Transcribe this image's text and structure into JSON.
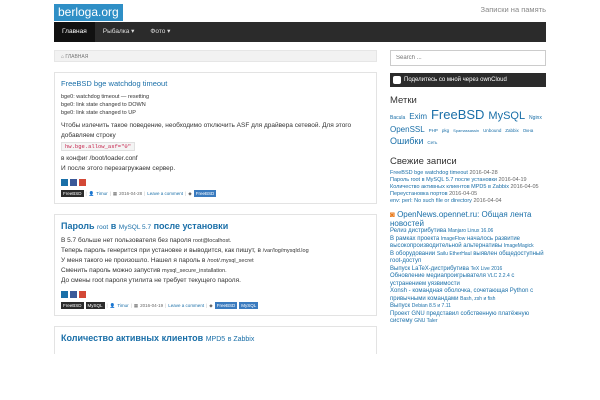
{
  "site": {
    "logo": "berloga.org",
    "tagline": "Записки на память"
  },
  "nav": {
    "items": [
      {
        "label": "Главная"
      },
      {
        "label": "Рыбалка ▾"
      },
      {
        "label": "Фото ▾"
      }
    ]
  },
  "breadcrumb": "ГЛАВНАЯ",
  "posts": [
    {
      "title": "FreeBSD bge watchdog timeout",
      "log": [
        "bge0: watchdog timeout — resetting",
        "bge0: link state changed to DOWN",
        "bge0: link state changed to UP"
      ],
      "p1": "Чтобы излечить такое поведение, необходимо отключить ASF для драйвера сетевой. Для этого добавляем строку",
      "code": "hw.bge.allow_asf=\"0\"",
      "p2": "в конфиг /boot/loader.conf",
      "p3": "И после этого перезагружаем сервер.",
      "meta": {
        "cat": "FreeBSD",
        "author": "Timur",
        "date": "2016-04-28",
        "comment": "Leave a comment",
        "tag": "FreeBSD"
      }
    },
    {
      "title_a": "Пароль",
      "title_b": "root",
      "title_c": "в",
      "title_d": "MySQL 5.7",
      "title_e": "после установки",
      "l1a": "В 5.7 больше нет пользователя без пароля",
      "l1b": "root@localhost.",
      "l2a": "Теперь пароль генерится при установке и выводится, как пишут, в",
      "l2b": "/var/log/mysqld.log",
      "l3a": "У меня такого не произошло. Нашел я пароль в",
      "l3b": "/root/.mysql_secret",
      "l4a": "Сменить пароль можно запустив",
      "l4b": "mysql_secure_installation.",
      "l5": "До смены root пароля утилита не требует текущего пароля.",
      "meta": {
        "cat1": "FreeBSD",
        "cat2": "MySQL",
        "author": "Timur",
        "date": "2016-04-19",
        "comment": "Leave a comment",
        "tag1": "FreeBSD",
        "tag2": "MySQL"
      }
    },
    {
      "title_a": "Количество активных клиентов",
      "title_b": "MPD5",
      "title_c": "в Zabbix"
    }
  ],
  "sidebar": {
    "search_placeholder": "Search ...",
    "owncloud_label": "Поделитесь со мной через ownCloud",
    "tags_title": "Метки",
    "tags": [
      {
        "t": "Bacula",
        "s": 5
      },
      {
        "t": "Exim",
        "s": 8
      },
      {
        "t": "FreeBSD",
        "s": 13
      },
      {
        "t": "MySQL",
        "s": 11
      },
      {
        "t": "Nginx",
        "s": 5
      },
      {
        "t": "OpenSSL",
        "s": 8
      },
      {
        "t": "PHP",
        "s": 4.5
      },
      {
        "t": "pkg",
        "s": 4.5
      },
      {
        "t": "Spamassassin",
        "s": 4
      },
      {
        "t": "Unbound",
        "s": 4.5
      },
      {
        "t": "Zabbix",
        "s": 4.5
      },
      {
        "t": "Окна",
        "s": 4.5
      },
      {
        "t": "Ошибки",
        "s": 9
      },
      {
        "t": "Сеть",
        "s": 4.5
      }
    ],
    "recent_title": "Свежие записи",
    "recent": [
      {
        "t": "FreeBSD bge watchdog timeout",
        "d": "2016-04-28"
      },
      {
        "t": "Пароль root в MySQL 5.7 после установки",
        "d": "2016-04-19"
      },
      {
        "t": "Количество активных клиентов MPD5 в Zabbix",
        "d": "2016-04-05"
      },
      {
        "t": "Переустановка портов",
        "d": "2016-04-05"
      },
      {
        "t": "env: perl: No such file or directory",
        "d": "2016-04-04"
      }
    ],
    "news_title": "OpenNews.opennet.ru: Общая лента новостей",
    "news": [
      {
        "a": "Релиз дистрибутива ",
        "b": "Manjaro Linux 16.06"
      },
      {
        "a": "В рамках проекта ",
        "b": "ImageFlow",
        "c": " началось развитие высокопроизводительной альтернативы ",
        "d": "ImageMagick"
      },
      {
        "a": "В оборудовании ",
        "b": "Sailu EtherHaul",
        " c": "",
        "c": " выявлен общедоступный root-доступ"
      },
      {
        "a": "Выпуск LaTeX-дистрибутива ",
        "b": "TeX Live 2016"
      },
      {
        "a": "Обновление медиапроигрывателя ",
        "b": "VLC 2.2.4",
        "c": " с устранением уязвимости"
      },
      {
        "a": "Xonsh - командная оболочка, сочетающая Python с привычными командами ",
        "b": "Bash, zsh и fish"
      },
      {
        "a": "Выпуск ",
        "b": "Debian 8.5 и 7.11"
      },
      {
        "a": "Проект GNU представил собственную платёжную систему ",
        "b": "GNU Taler"
      }
    ]
  }
}
